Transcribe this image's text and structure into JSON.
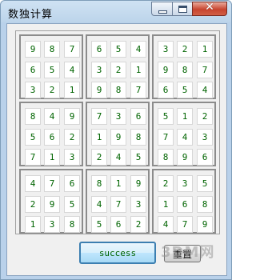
{
  "window": {
    "title": "数独计算",
    "minimize_glyph": "",
    "maximize_glyph": "",
    "close_glyph": "✕"
  },
  "grid": [
    [
      "9",
      "8",
      "7",
      "6",
      "5",
      "4",
      "3",
      "2",
      "1"
    ],
    [
      "6",
      "5",
      "4",
      "3",
      "2",
      "1",
      "9",
      "8",
      "7"
    ],
    [
      "3",
      "2",
      "1",
      "9",
      "8",
      "7",
      "6",
      "5",
      "4"
    ],
    [
      "8",
      "4",
      "9",
      "7",
      "3",
      "6",
      "5",
      "1",
      "2"
    ],
    [
      "5",
      "6",
      "2",
      "1",
      "9",
      "8",
      "7",
      "4",
      "3"
    ],
    [
      "7",
      "1",
      "3",
      "2",
      "4",
      "5",
      "8",
      "9",
      "6"
    ],
    [
      "4",
      "7",
      "6",
      "8",
      "1",
      "9",
      "2",
      "3",
      "5"
    ],
    [
      "2",
      "9",
      "5",
      "4",
      "7",
      "3",
      "1",
      "6",
      "8"
    ],
    [
      "1",
      "3",
      "8",
      "5",
      "6",
      "2",
      "4",
      "7",
      "9"
    ]
  ],
  "buttons": {
    "success_label": "success",
    "redo_label": "重置"
  },
  "watermark": "3DM网"
}
